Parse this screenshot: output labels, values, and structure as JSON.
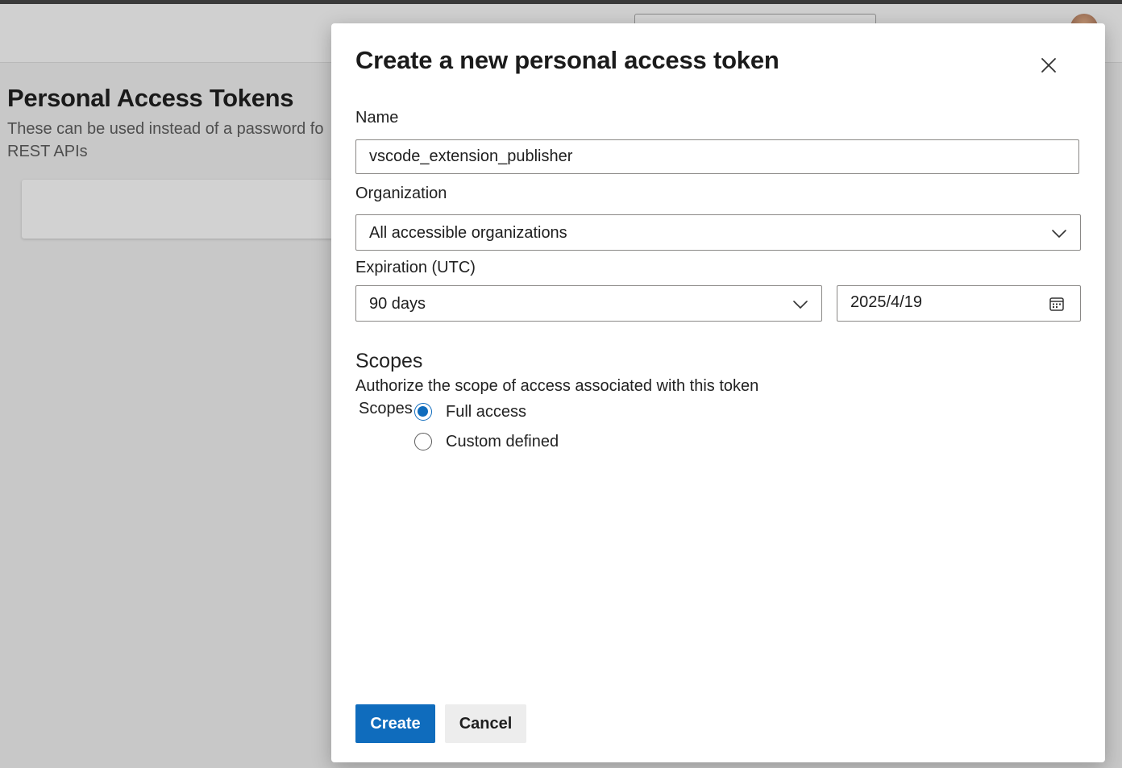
{
  "background": {
    "page_title": "Personal Access Tokens",
    "page_subtitle": "These can be used instead of a password fo",
    "page_subtitle_line2": "REST APIs"
  },
  "dialog": {
    "title": "Create a new personal access token",
    "name": {
      "label": "Name",
      "value": "vscode_extension_publisher"
    },
    "organization": {
      "label": "Organization",
      "selected": "All accessible organizations"
    },
    "expiration": {
      "label": "Expiration (UTC)",
      "duration": "90 days",
      "date": "2025/4/19"
    },
    "scopes": {
      "title": "Scopes",
      "description": "Authorize the scope of access associated with this token",
      "group_label": "Scopes",
      "options": [
        {
          "label": "Full access",
          "checked": true
        },
        {
          "label": "Custom defined",
          "checked": false
        }
      ]
    },
    "buttons": {
      "create": "Create",
      "cancel": "Cancel"
    }
  },
  "colors": {
    "accent": "#0f6cbd",
    "overlay": "#c8c8c8",
    "dialog_bg": "#ffffff"
  },
  "icons": {
    "close": "close-icon",
    "chevron": "chevron-down-icon",
    "calendar": "calendar-icon"
  }
}
